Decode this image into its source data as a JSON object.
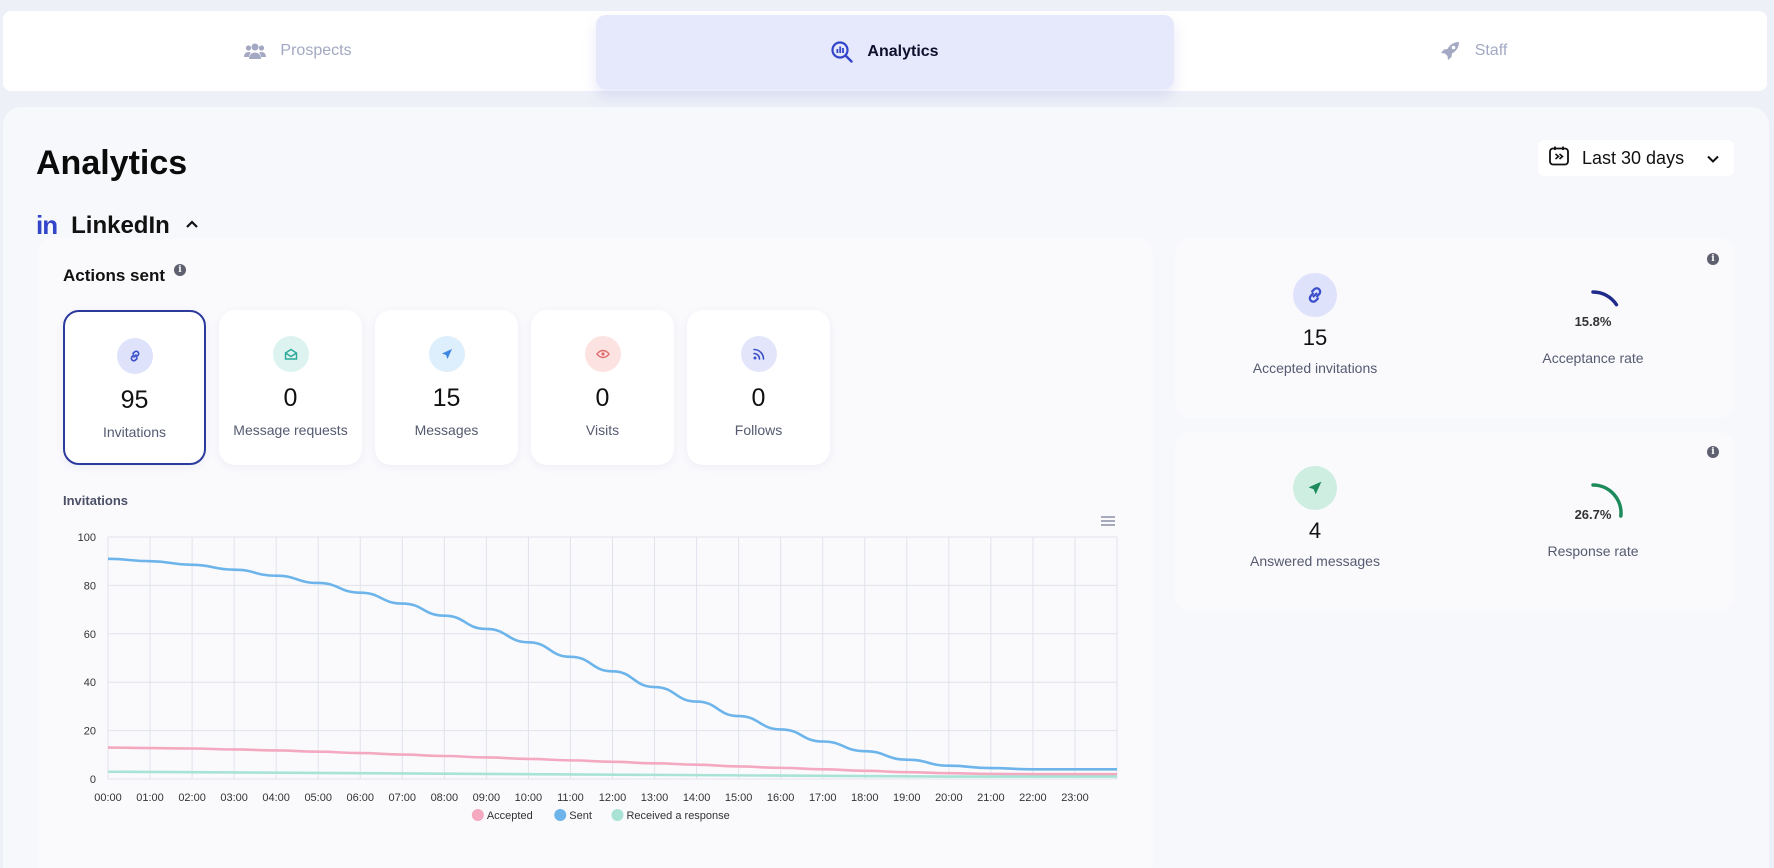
{
  "nav": {
    "tabs": [
      {
        "label": "Prospects",
        "icon": "users-icon"
      },
      {
        "label": "Analytics",
        "icon": "analytics-search-icon"
      },
      {
        "label": "Staff",
        "icon": "rocket-icon"
      }
    ],
    "active": "Analytics"
  },
  "page": {
    "title": "Analytics"
  },
  "date_range": {
    "label": "Last 30 days"
  },
  "section": {
    "logo": "in",
    "title": "LinkedIn"
  },
  "actions": {
    "title": "Actions sent",
    "tiles": [
      {
        "value": "95",
        "label": "Invitations",
        "icon": "link-icon",
        "color": "#3b4fc9",
        "bg": "#dfe2fb"
      },
      {
        "value": "0",
        "label": "Message requests",
        "icon": "mail-open-icon",
        "color": "#2aa89a",
        "bg": "#dcf3ef"
      },
      {
        "value": "15",
        "label": "Messages",
        "icon": "send-icon",
        "color": "#3c88e0",
        "bg": "#ddeefc"
      },
      {
        "value": "0",
        "label": "Visits",
        "icon": "eye-icon",
        "color": "#e06b6b",
        "bg": "#fde2e2"
      },
      {
        "value": "0",
        "label": "Follows",
        "icon": "rss-icon",
        "color": "#3b4fc9",
        "bg": "#e3e6fb"
      }
    ]
  },
  "chart_title": "Invitations",
  "chart_data": {
    "type": "line",
    "x": [
      "00:00",
      "01:00",
      "02:00",
      "03:00",
      "04:00",
      "05:00",
      "06:00",
      "07:00",
      "08:00",
      "09:00",
      "10:00",
      "11:00",
      "12:00",
      "13:00",
      "14:00",
      "15:00",
      "16:00",
      "17:00",
      "18:00",
      "19:00",
      "20:00",
      "21:00",
      "22:00",
      "23:00"
    ],
    "ylim": [
      0,
      100
    ],
    "yticks": [
      0,
      20,
      40,
      60,
      80,
      100
    ],
    "grid": true,
    "legend": "bottom",
    "series": [
      {
        "name": "Accepted",
        "color": "#f4a9c0",
        "values": [
          13,
          12.8,
          12.6,
          12.2,
          11.8,
          11.3,
          10.7,
          10.1,
          9.5,
          8.9,
          8.3,
          7.7,
          7.1,
          6.5,
          5.9,
          5.2,
          4.6,
          4,
          3.4,
          2.8,
          2.4,
          2.1,
          2,
          2
        ]
      },
      {
        "name": "Sent",
        "color": "#6cb4ea",
        "values": [
          91,
          90,
          88.5,
          86.5,
          84,
          81,
          77,
          72.5,
          67.5,
          62,
          56.5,
          50.5,
          44.5,
          38,
          32,
          26,
          20.5,
          15.5,
          11.5,
          8,
          5.5,
          4.5,
          4,
          4
        ]
      },
      {
        "name": "Received a response",
        "color": "#a9e3d6",
        "values": [
          3,
          2.9,
          2.8,
          2.7,
          2.6,
          2.5,
          2.4,
          2.3,
          2.2,
          2.1,
          2,
          1.9,
          1.8,
          1.7,
          1.6,
          1.5,
          1.4,
          1.3,
          1.2,
          1.1,
          1,
          1,
          1,
          1
        ]
      }
    ]
  },
  "invitations_stats": {
    "value": "15",
    "caption": "Accepted invitations",
    "rate_label": "15.8%",
    "rate_value": 15.8,
    "rate_caption": "Acceptance rate",
    "color": "#1f2a8a",
    "icon": "link-icon"
  },
  "messages_stats": {
    "value": "4",
    "caption": "Answered messages",
    "rate_label": "26.7%",
    "rate_value": 26.7,
    "rate_caption": "Response rate",
    "color": "#1c8a5a",
    "icon": "send-icon"
  }
}
